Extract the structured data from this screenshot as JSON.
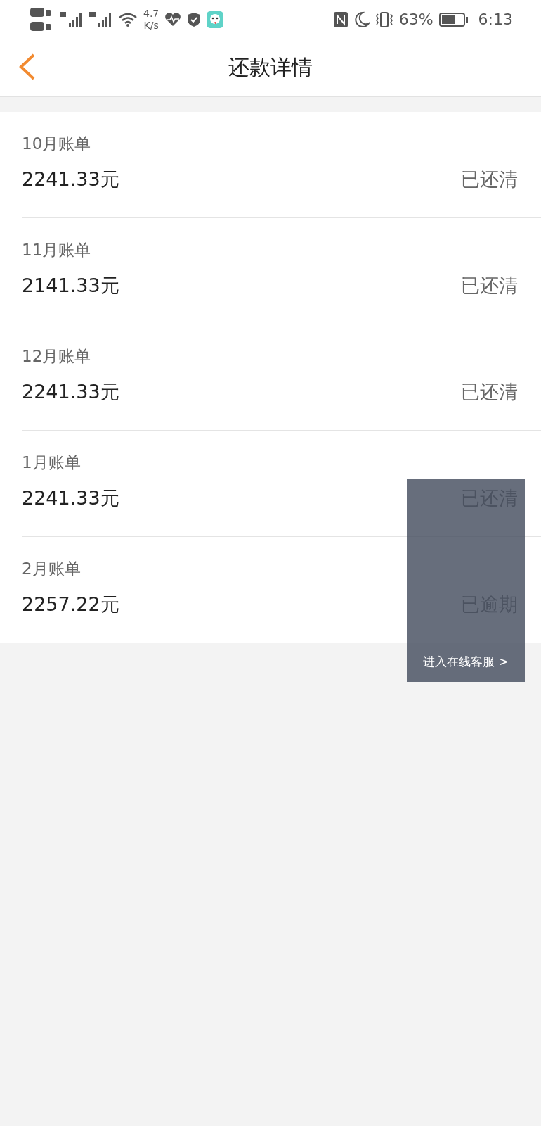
{
  "status_bar": {
    "speed": "4.7",
    "speed_unit": "K/s",
    "battery": "63%",
    "time": "6:13"
  },
  "header": {
    "title": "还款详情"
  },
  "bills": [
    {
      "period": "10月账单",
      "amount": "2241.33元",
      "status": "已还清"
    },
    {
      "period": "11月账单",
      "amount": "2141.33元",
      "status": "已还清"
    },
    {
      "period": "12月账单",
      "amount": "2241.33元",
      "status": "已还清"
    },
    {
      "period": "1月账单",
      "amount": "2241.33元",
      "status": "已还清"
    },
    {
      "period": "2月账单",
      "amount": "2257.22元",
      "status": "已逾期"
    }
  ],
  "support_panel": {
    "label": "进入在线客服 >"
  }
}
